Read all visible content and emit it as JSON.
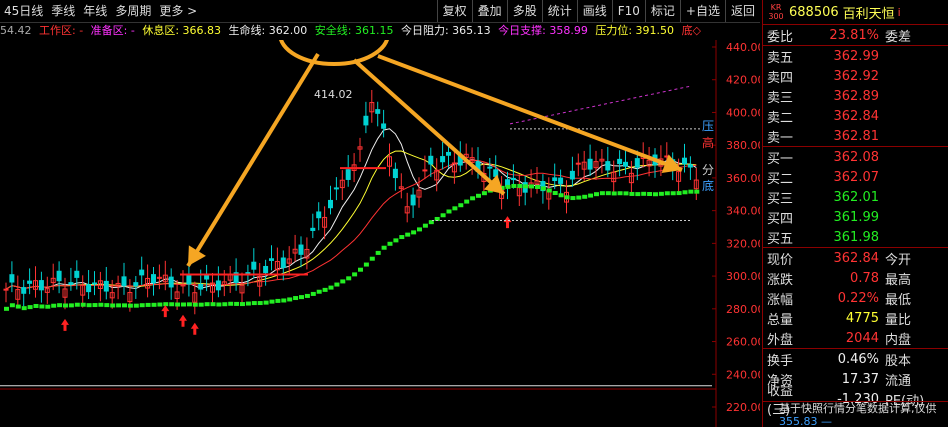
{
  "period_tabs": [
    "45日线",
    "季线",
    "年线",
    "多周期",
    "更多 >"
  ],
  "toolbar": [
    "复权",
    "叠加",
    "多股",
    "统计",
    "画线",
    "F10",
    "标记",
    "+自选",
    "返回"
  ],
  "legend": {
    "price": "54.42",
    "work_zone": "工作区: -",
    "prep_zone": "准备区: -",
    "rest_zone": "休息区: 366.83",
    "life_line": "生命线: 362.00",
    "safe_line": "安全线: 361.15",
    "resist_today": "今日阻力: 365.13",
    "support_today": "今日支撑: 358.99",
    "pressure": "压力位: 391.50",
    "bottom": "底◇"
  },
  "colors": {
    "up": "#ff3333",
    "down": "#00d2d2",
    "safe_line": "#22ee22",
    "annotation": "#f5a623"
  },
  "chart_labels": {
    "peak_price": "414.02",
    "zone_ya": "压",
    "zone_gao": "高",
    "zone_fen": "分",
    "zone_di": "底"
  },
  "y_axis": [
    "440.00",
    "420.00",
    "400.00",
    "380.00",
    "360.00",
    "340.00",
    "320.00",
    "300.00",
    "280.00",
    "260.00",
    "240.00",
    "220.00"
  ],
  "stock": {
    "market": "KR",
    "market_sub": "300",
    "code": "688506",
    "name": "百利天恒",
    "info": "i"
  },
  "order_ratio": {
    "label": "委比",
    "value": "23.81%",
    "label2": "委差"
  },
  "asks": [
    {
      "label": "卖五",
      "price": "362.99"
    },
    {
      "label": "卖四",
      "price": "362.92"
    },
    {
      "label": "卖三",
      "price": "362.89"
    },
    {
      "label": "卖二",
      "price": "362.84"
    },
    {
      "label": "卖一",
      "price": "362.81"
    }
  ],
  "bids": [
    {
      "label": "买一",
      "price": "362.08"
    },
    {
      "label": "买二",
      "price": "362.07"
    },
    {
      "label": "买三",
      "price": "362.01"
    },
    {
      "label": "买四",
      "price": "361.99"
    },
    {
      "label": "买五",
      "price": "361.98"
    }
  ],
  "quote": [
    {
      "label": "现价",
      "value": "362.84",
      "label2": "今开",
      "cls": "red"
    },
    {
      "label": "涨跌",
      "value": "0.78",
      "label2": "最高",
      "cls": "red"
    },
    {
      "label": "涨幅",
      "value": "0.22%",
      "label2": "最低",
      "cls": "red"
    },
    {
      "label": "总量",
      "value": "4775",
      "label2": "量比",
      "cls": "yellow"
    },
    {
      "label": "外盘",
      "value": "2044",
      "label2": "内盘",
      "cls": "red"
    }
  ],
  "stats": [
    {
      "label": "换手",
      "value": "0.46%",
      "label2": "股本"
    },
    {
      "label": "净资",
      "value": "17.37",
      "label2": "流通"
    },
    {
      "label": "收益(三)",
      "value": "-1.230",
      "label2": "PE(动)"
    }
  ],
  "footnote": "基于快照行情分笔数据计算,仅供",
  "footnote2": "355.83 —"
}
